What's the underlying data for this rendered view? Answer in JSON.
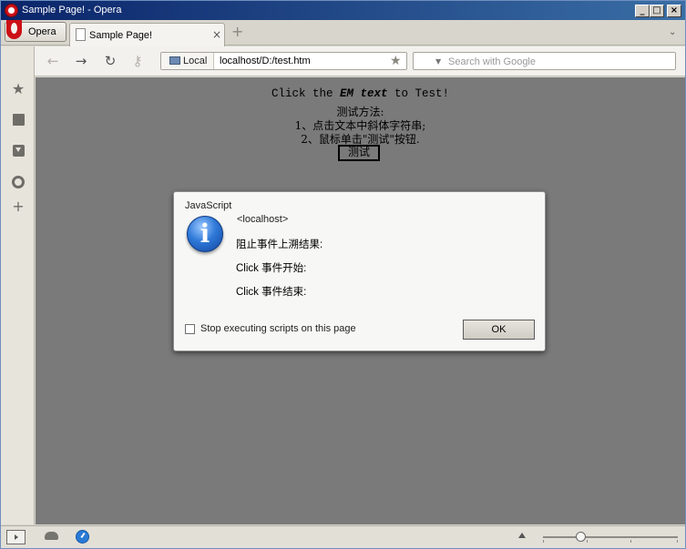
{
  "window": {
    "title": "Sample Page! - Opera",
    "min_glyph": "_",
    "max_glyph": "□",
    "close_glyph": "×"
  },
  "tabs": {
    "menu_label": "Opera",
    "active_tab": "Sample Page!",
    "close_glyph": "×",
    "new_tab_glyph": "+",
    "menu_glyph": "⌄"
  },
  "address": {
    "badge": "Local",
    "url": "localhost/D:/test.htm",
    "search_placeholder": "Search with Google",
    "back_glyph": "←",
    "forward_glyph": "→",
    "reload_glyph": "↻",
    "key_glyph": "⚷",
    "star_glyph": "★",
    "search_caret": "▼"
  },
  "sidebar": {
    "bookmarks_glyph": "★",
    "add_glyph": "+"
  },
  "page": {
    "line1_prefix": "Click the ",
    "line1_em": "EM text",
    "line1_suffix": " to Test!",
    "line2": "测试方法:",
    "line3": "1、点击文本中斜体字符串;",
    "line4": "2、鼠标单击\"测试\"按钮.",
    "button": "测试"
  },
  "dialog": {
    "title": "JavaScript",
    "icon_glyph": "i",
    "origin": "<localhost>",
    "message1": "阻止事件上溯结果:",
    "message2": "Click 事件开始:",
    "message3": "Click 事件结束:",
    "checkbox_label": "Stop executing scripts on this page",
    "ok": "OK"
  },
  "statusbar": {
    "zoom_level": 0.28
  },
  "icons": {
    "bookmarks": "star-icon",
    "notes": "notes-icon",
    "downloads": "downloads-icon",
    "history": "clock-icon",
    "add_panel": "plus-icon",
    "info": "info-icon"
  },
  "colors": {
    "titlebar_start": "#0a246a",
    "titlebar_end": "#3a6ea5",
    "content_bg": "#7a7a7a",
    "dialog_bg": "#f7f7f5",
    "opera_red": "#cc0f16",
    "info_blue": "#2f79d8"
  }
}
